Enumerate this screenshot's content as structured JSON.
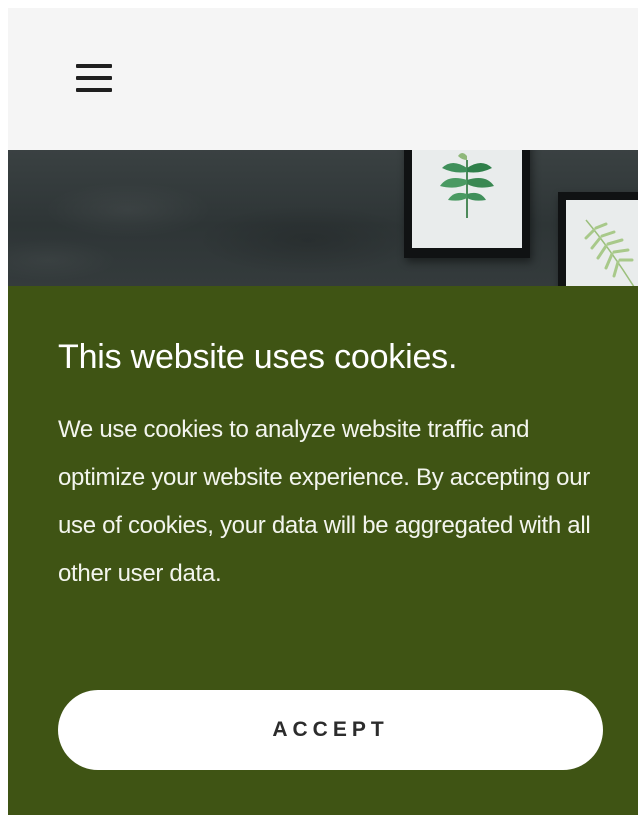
{
  "header": {
    "menu_icon": "hamburger-menu-icon"
  },
  "hero": {
    "description_icons": [
      "framed-plant-print-icon",
      "framed-fern-print-icon"
    ]
  },
  "cookie_banner": {
    "title": "This website uses cookies.",
    "body": "We use cookies to analyze website traffic and optimize your website experience. By accepting our use of cookies, your data will be aggregated with all other user data.",
    "accept_label": "ACCEPT",
    "background_color": "#3f5414",
    "button_color": "#ffffff"
  }
}
